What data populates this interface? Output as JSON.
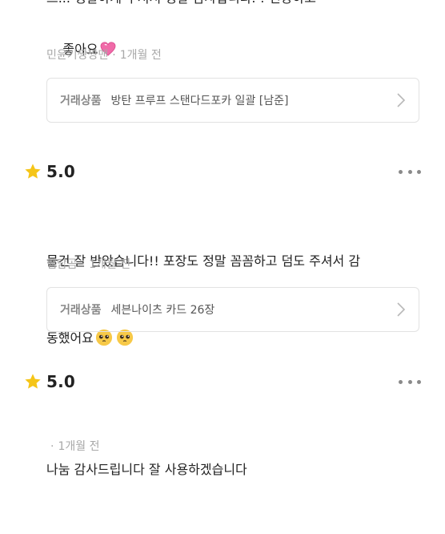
{
  "reviews": [
    {
      "body_line1": "드... 정갈하게 주셔서 정말 감사합니다.  ! 번창하고",
      "body_line2": "좋아요",
      "body_emoji": "heart-icon",
      "author": "민윤기짱짱맨",
      "time": "1개월 전",
      "deal_label": "거래상품",
      "deal_title": "방탄 프루프 스탠다드포카 일괄 [남준]"
    },
    {
      "score": "5.0",
      "body_line1": "물건 잘 받았습니다!! 포장도 정말 꼼꼼하고 덤도 주셔서 감",
      "body_line2": "동했어요",
      "body_emoji": "pleading-face-icon",
      "author": "햄담곰",
      "time": "1개월 전",
      "deal_label": "거래상품",
      "deal_title": "세븐나이츠 카드 26장"
    },
    {
      "score": "5.0",
      "body_line1": "나눔 감사드립니다 잘 사용하겠습니다",
      "author": "",
      "time": "1개월 전"
    }
  ],
  "colors": {
    "star": "#f5c518",
    "text": "#222222",
    "meta": "#a8a8a8",
    "border": "#e2e2e2",
    "heart": "#f06aa8",
    "emoji": "#f7c948"
  }
}
